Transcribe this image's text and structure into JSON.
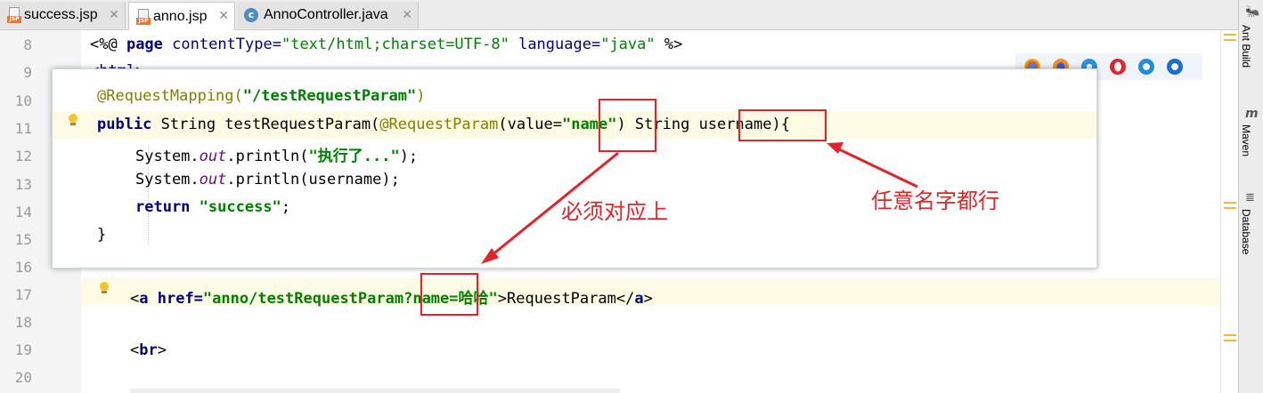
{
  "tabs": [
    {
      "label": "success.jsp",
      "icon": "jsp-file-icon",
      "active": false
    },
    {
      "label": "anno.jsp",
      "icon": "jsp-file-icon",
      "active": true
    },
    {
      "label": "AnnoController.java",
      "icon": "java-class-icon",
      "active": false
    }
  ],
  "gutter": {
    "line_numbers": [
      "8",
      "9",
      "10",
      "11",
      "12",
      "13",
      "14",
      "15",
      "16",
      "17",
      "18",
      "19",
      "20"
    ]
  },
  "editor": {
    "line8": {
      "open": "<%@ ",
      "page": "page",
      "attr1": " contentType=",
      "val1": "\"text/html;charset=UTF-8\"",
      "attr2": " language=",
      "val2": "\"java\"",
      "close": " %>"
    },
    "line9_partial": "<html>",
    "line17": {
      "lt": "<",
      "a": "a",
      "href_attr": " href=",
      "href_val_a": "\"anno/testRequestParam",
      "href_val_b": "?name",
      "href_val_c": "=",
      "href_val_d": "哈哈\"",
      "gt": ">",
      "text": "RequestParam",
      "close_open": "</",
      "close_a": "a",
      "close_gt": ">"
    },
    "line19": {
      "lt": "<",
      "br": "br",
      "gt": ">"
    }
  },
  "popup": {
    "line1": {
      "ann": "@RequestMapping(",
      "str": "\"/testRequestParam\"",
      "close": ")"
    },
    "line2": {
      "kw": "public",
      "sig": " String testRequestParam(",
      "ann": "@RequestParam",
      "open": "(value=",
      "str": "\"name\"",
      "after": ") String ",
      "param": "username",
      "end": "){"
    },
    "line3": {
      "a": "System.",
      "field": "out",
      "b": ".println(",
      "str": "\"执行了...\"",
      "c": ");"
    },
    "line4": {
      "a": "System.",
      "field": "out",
      "b": ".println(username);"
    },
    "line5": {
      "kw": "return",
      "sp": " ",
      "str": "\"success\"",
      "end": ";"
    },
    "line6": "}"
  },
  "annotations": {
    "must_match": "必须对应上",
    "any_name": "任意名字都行"
  },
  "side_panel": {
    "items": [
      {
        "label": "Ant Build",
        "icon": "ant-icon"
      },
      {
        "label": "Maven",
        "icon": "maven-icon"
      },
      {
        "label": "Database",
        "icon": "database-icon"
      }
    ]
  },
  "browsers": [
    "chrome-icon",
    "firefox-icon",
    "safari-icon",
    "opera-icon",
    "ie-icon",
    "edge-icon"
  ],
  "colors": {
    "annotation_red": "#e0242a",
    "keyword": "#000080",
    "string": "#008000",
    "annotation": "#808000"
  }
}
